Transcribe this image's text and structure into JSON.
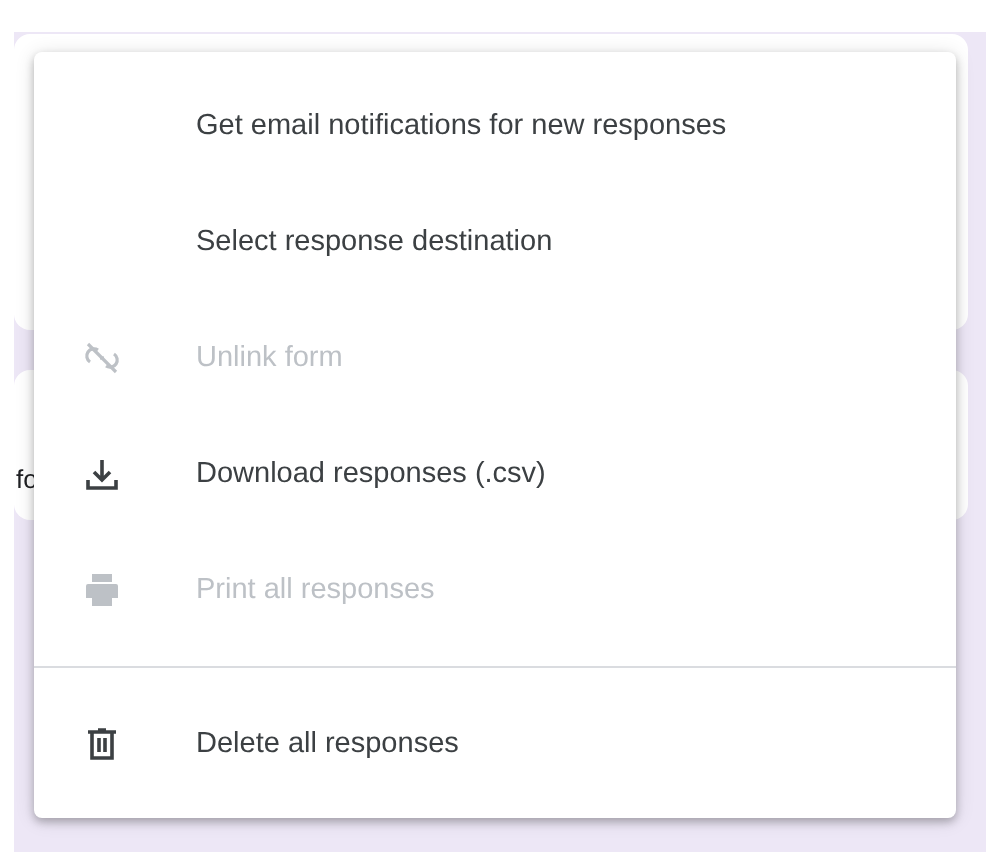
{
  "background": {
    "partial_text": "fo"
  },
  "menu": {
    "sections": [
      [
        {
          "kind": "none",
          "label": "Get email notifications for new responses",
          "disabled": false
        },
        {
          "kind": "none",
          "label": "Select response destination",
          "disabled": false
        },
        {
          "kind": "unlink",
          "label": "Unlink form",
          "disabled": true
        },
        {
          "kind": "download",
          "label": "Download responses (.csv)",
          "disabled": false
        },
        {
          "kind": "print",
          "label": "Print all responses",
          "disabled": true
        }
      ],
      [
        {
          "kind": "delete",
          "label": "Delete all responses",
          "disabled": false
        }
      ]
    ]
  }
}
